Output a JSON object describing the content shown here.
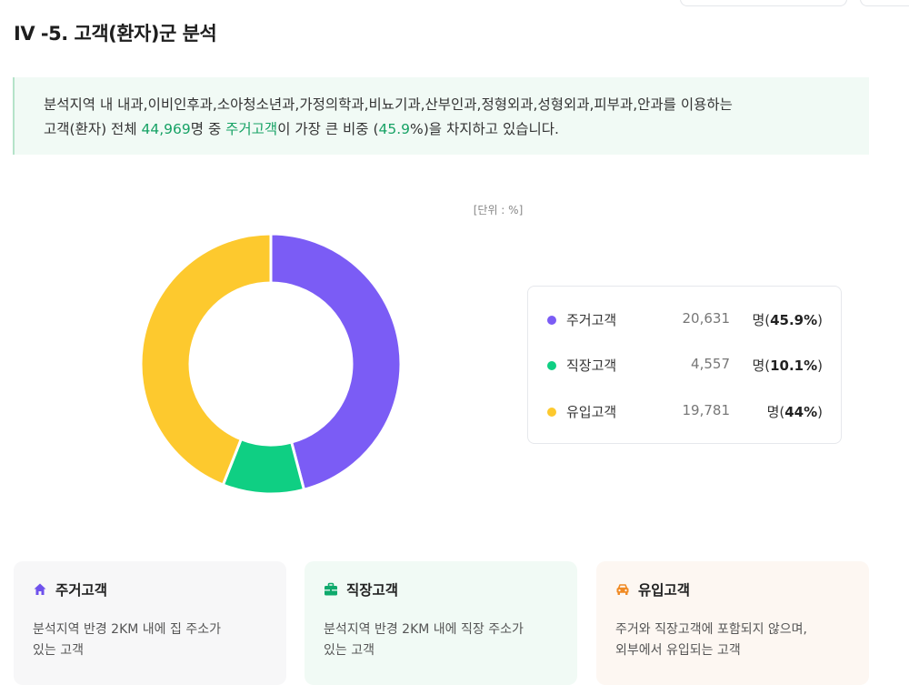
{
  "header": {
    "title": "IV -5. 고객(환자)군 분석"
  },
  "summary": {
    "line1": "분석지역 내 내과,이비인후과,소아청소년과,가정의학과,비뇨기과,산부인과,정형외과,성형외과,피부과,안과를 이용하는",
    "line2_prefix": "고객(환자) 전체 ",
    "total": "44,969",
    "line2_mid1": "명 중 ",
    "top_group": "주거고객",
    "line2_mid2": "이 가장 큰 비중 (",
    "top_pct": "45.9",
    "line2_suffix": "%)을 차지하고 있습니다."
  },
  "unit_label": "[단위 : %]",
  "colors": {
    "resident": "#7b5cf5",
    "workplace": "#0fcf83",
    "inflow": "#fdc92e",
    "highlight": "#17a265"
  },
  "chart_data": {
    "type": "pie",
    "donut": true,
    "unit": "%",
    "categories": [
      "주거고객",
      "직장고객",
      "유입고객"
    ],
    "values": [
      45.9,
      10.1,
      44
    ],
    "counts": [
      20631,
      4557,
      19781
    ]
  },
  "legend": [
    {
      "name": "주거고객",
      "value": "20,631",
      "unit_prefix": "명(",
      "pct": "45.9%",
      "unit_suffix": ")"
    },
    {
      "name": "직장고객",
      "value": "4,557",
      "unit_prefix": "명(",
      "pct": "10.1%",
      "unit_suffix": ")"
    },
    {
      "name": "유입고객",
      "value": "19,781",
      "unit_prefix": "명(",
      "pct": "44%",
      "unit_suffix": ")"
    }
  ],
  "cards": [
    {
      "title": "주거고객",
      "icon": "home-icon",
      "desc": [
        "분석지역 반경 2KM 내에 집 주소가",
        "있는 고객"
      ]
    },
    {
      "title": "직장고객",
      "icon": "briefcase-icon",
      "desc": [
        "분석지역 반경 2KM 내에 직장 주소가",
        "있는 고객"
      ]
    },
    {
      "title": "유입고객",
      "icon": "car-icon",
      "desc": [
        "주거와 직장고객에 포함되지 않으며,",
        "외부에서 유입되는 고객"
      ]
    }
  ]
}
